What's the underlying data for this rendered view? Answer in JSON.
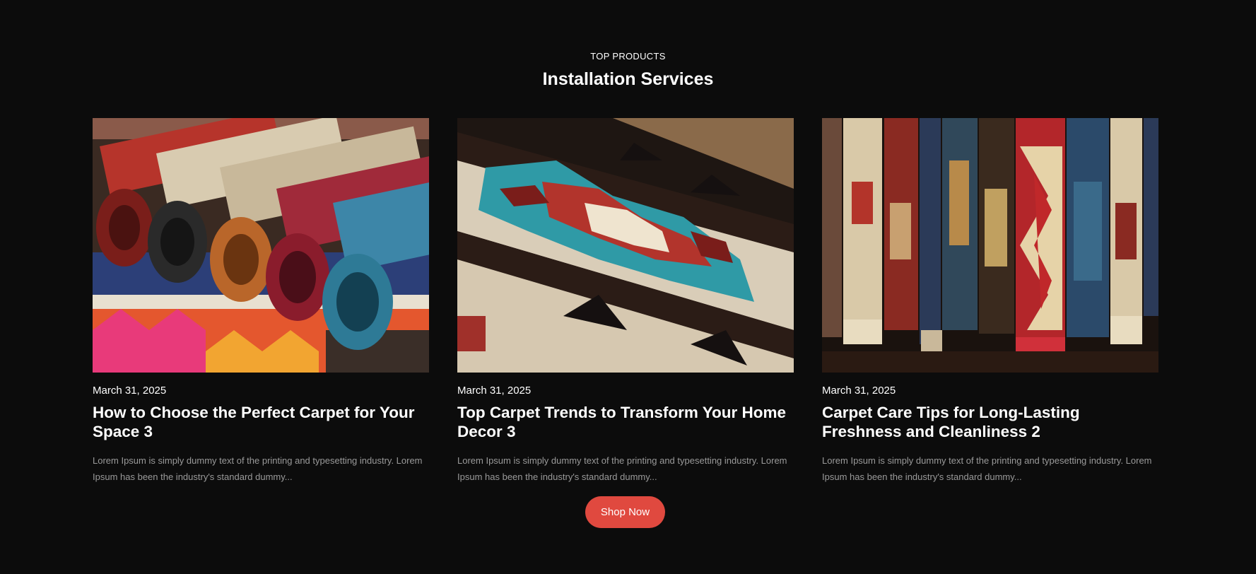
{
  "section": {
    "eyebrow": "TOP PRODUCTS",
    "title": "Installation Services"
  },
  "cards": [
    {
      "image": "rolled-colorful-rugs-photo",
      "date": "March 31, 2025",
      "title": "How to Choose the Perfect Carpet for Your Space 3",
      "excerpt": "Lorem Ipsum is simply dummy text of the printing and typesetting industry. Lorem Ipsum has been the industry's standard dummy..."
    },
    {
      "image": "woven-geometric-carpet-closeup-photo",
      "date": "March 31, 2025",
      "title": "Top Carpet Trends to Transform Your Home Decor 3",
      "excerpt": "Lorem Ipsum is simply dummy text of the printing and typesetting industry. Lorem Ipsum has been the industry's standard dummy..."
    },
    {
      "image": "hanging-oriental-rugs-photo",
      "date": "March 31, 2025",
      "title": "Carpet Care Tips for Long-Lasting Freshness and Cleanliness 2",
      "excerpt": "Lorem Ipsum is simply dummy text of the printing and typesetting industry. Lorem Ipsum has been the industry's standard dummy..."
    }
  ],
  "cta": {
    "label": "Shop Now"
  },
  "colors": {
    "background": "#0c0c0c",
    "accent": "#e0493f",
    "muted_text": "#9a9a9a"
  }
}
